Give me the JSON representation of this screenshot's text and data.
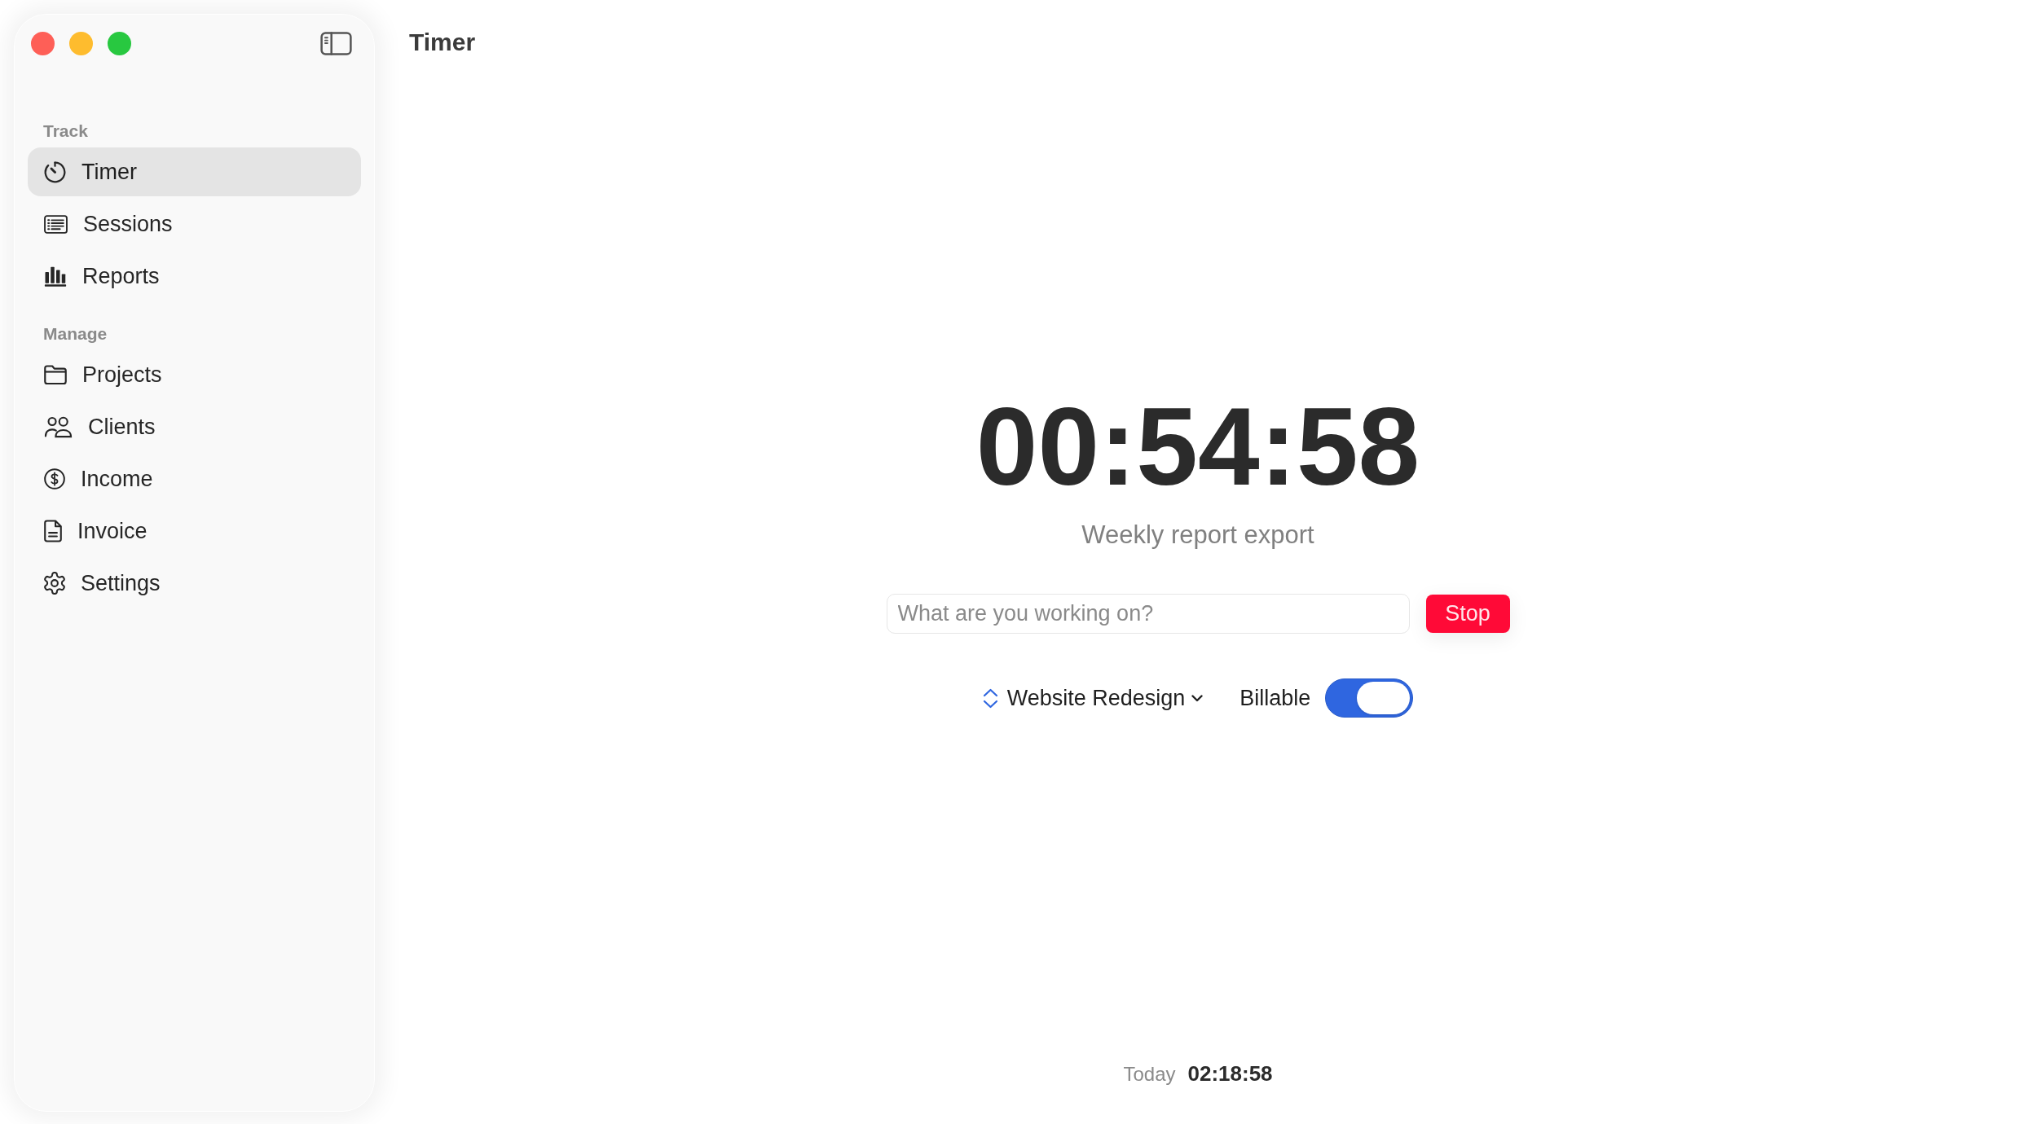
{
  "toolbar": {
    "title": "Timer"
  },
  "sidebar": {
    "sections": [
      {
        "heading": "Track",
        "items": [
          {
            "label": "Timer",
            "selected": true
          },
          {
            "label": "Sessions",
            "selected": false
          },
          {
            "label": "Reports",
            "selected": false
          }
        ]
      },
      {
        "heading": "Manage",
        "items": [
          {
            "label": "Projects",
            "selected": false
          },
          {
            "label": "Clients",
            "selected": false
          },
          {
            "label": "Income",
            "selected": false
          },
          {
            "label": "Invoice",
            "selected": false
          },
          {
            "label": "Settings",
            "selected": false
          }
        ]
      }
    ]
  },
  "timer": {
    "elapsed": "00:54:58",
    "task": "Weekly report export",
    "task_input": {
      "placeholder": "What are you working on?"
    },
    "stop_button": "Stop",
    "project": "Website Redesign",
    "billable": {
      "label": "Billable",
      "on": true
    }
  },
  "footer": {
    "label": "Today",
    "total": "02:18:58"
  }
}
